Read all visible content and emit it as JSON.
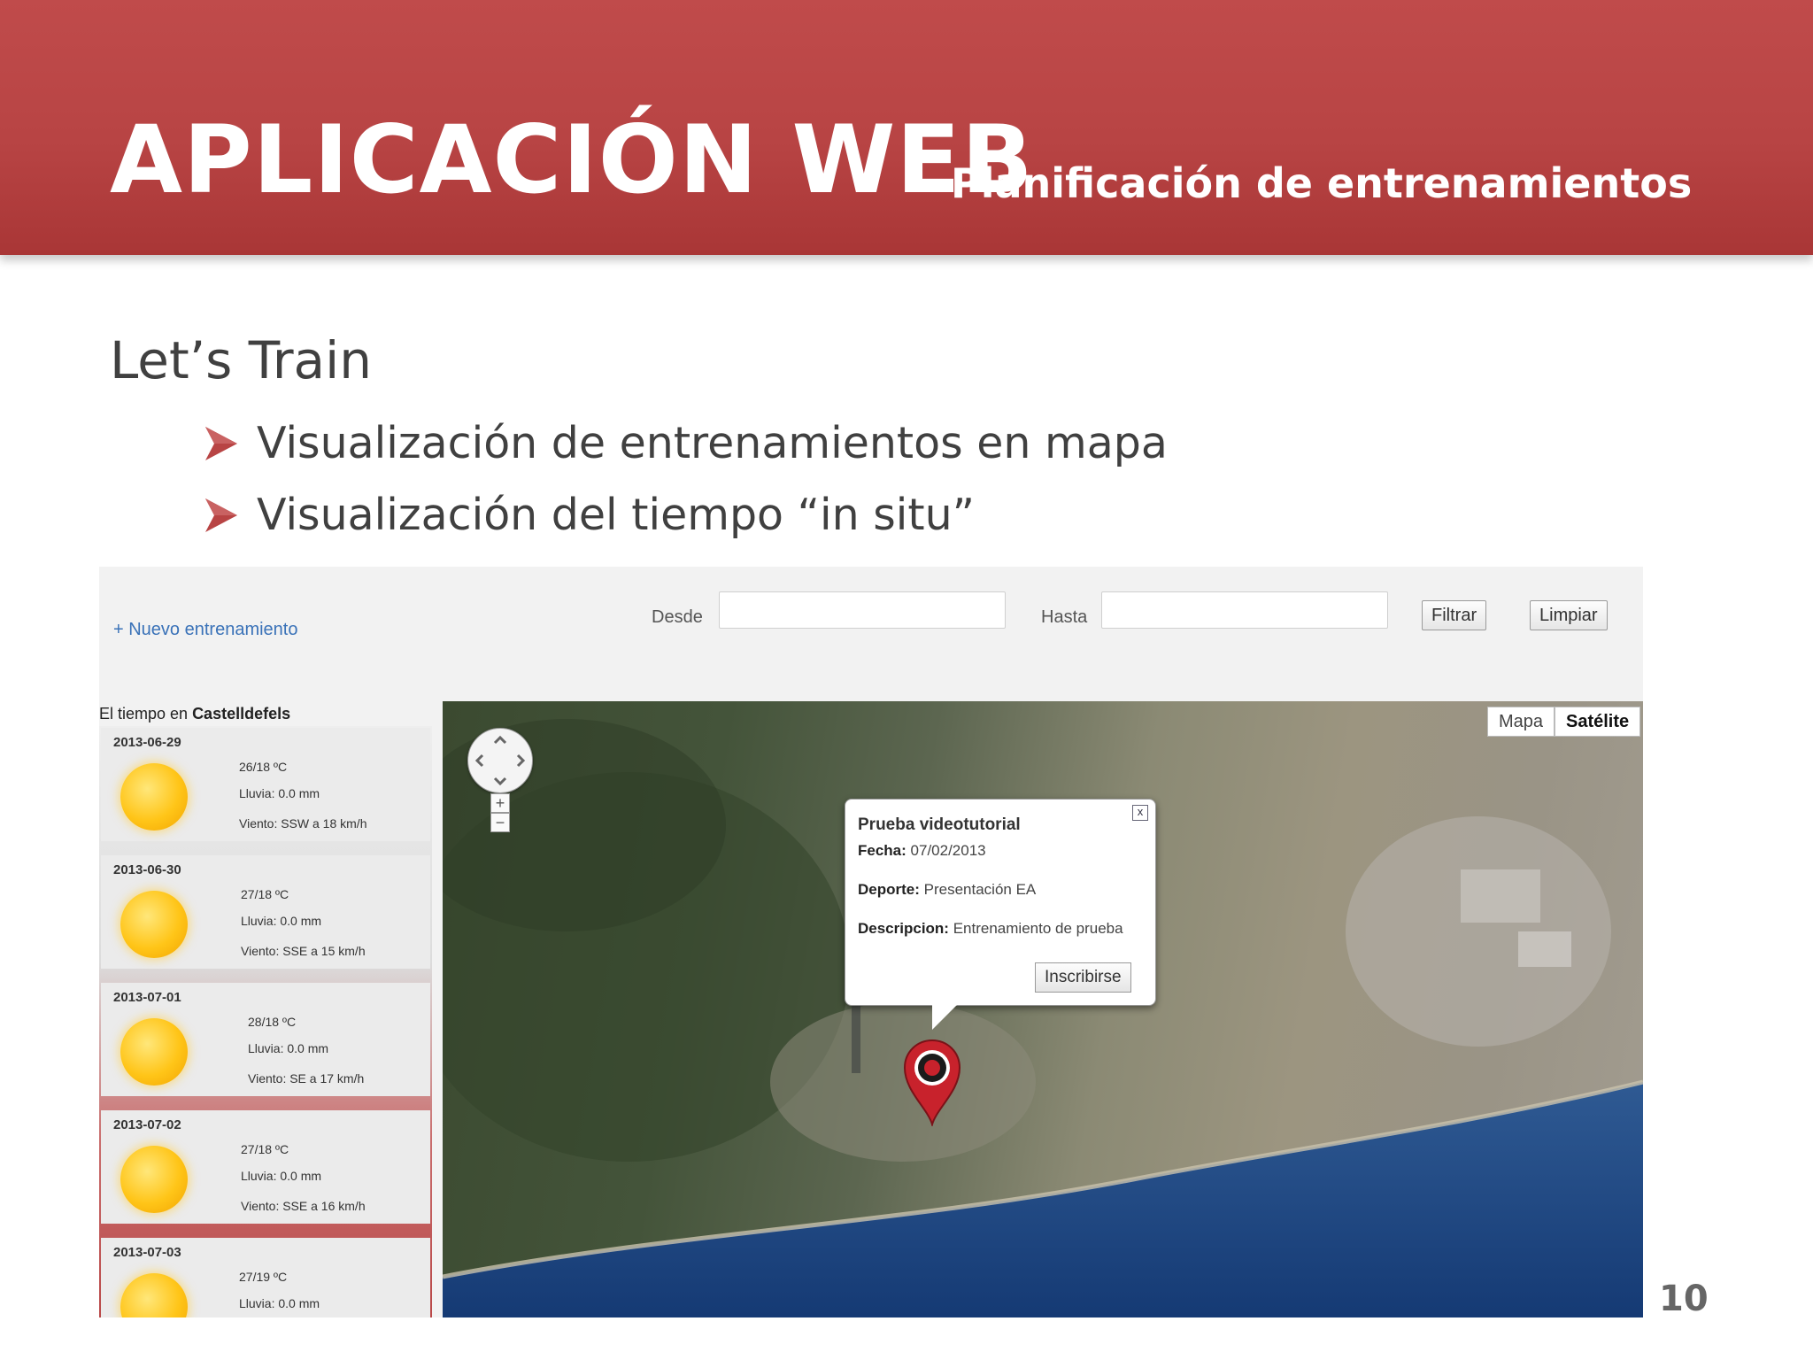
{
  "slide": {
    "title": "APLICACIÓN WEB",
    "subtitle": "Planificación de entrenamientos",
    "heading": "Let’s Train",
    "bullets": [
      "Visualización de entrenamientos en mapa",
      "Visualización del tiempo “in situ”"
    ],
    "page_number": "10",
    "accent_color": "#b84444"
  },
  "app": {
    "new_link": "+ Nuevo entrenamiento",
    "filter": {
      "from_label": "Desde",
      "from_value": "",
      "to_label": "Hasta",
      "to_value": "",
      "filter_button": "Filtrar",
      "clear_button": "Limpiar"
    },
    "weather": {
      "title_prefix": "El tiempo en ",
      "city": "Castelldefels",
      "days": [
        {
          "date": "2013-06-29",
          "temp": "26/18 ºC",
          "rain": "Lluvia: 0.0 mm",
          "wind": "Viento: SSW a 18 km/h",
          "icon": "sun-icon"
        },
        {
          "date": "2013-06-30",
          "temp": "27/18 ºC",
          "rain": "Lluvia: 0.0 mm",
          "wind": "Viento: SSE a 15 km/h",
          "icon": "sun-icon"
        },
        {
          "date": "2013-07-01",
          "temp": "28/18 ºC",
          "rain": "Lluvia: 0.0 mm",
          "wind": "Viento: SE a 17 km/h",
          "icon": "sun-icon"
        },
        {
          "date": "2013-07-02",
          "temp": "27/18 ºC",
          "rain": "Lluvia: 0.0 mm",
          "wind": "Viento: SSE a 16 km/h",
          "icon": "sun-icon"
        },
        {
          "date": "2013-07-03",
          "temp": "27/19 ºC",
          "rain": "Lluvia: 0.0 mm",
          "wind": "",
          "icon": "sun-icon"
        }
      ]
    },
    "map": {
      "type_map": "Mapa",
      "type_satellite": "Satélite",
      "zoom_in": "+",
      "zoom_out": "−",
      "popup": {
        "title": "Prueba videotutorial",
        "date_label": "Fecha:",
        "date_value": "07/02/2013",
        "sport_label": "Deporte:",
        "sport_value": "Presentación EA",
        "desc_label": "Descripcion:",
        "desc_value": "Entrenamiento de prueba",
        "button": "Inscribirse",
        "close": "x"
      }
    }
  }
}
